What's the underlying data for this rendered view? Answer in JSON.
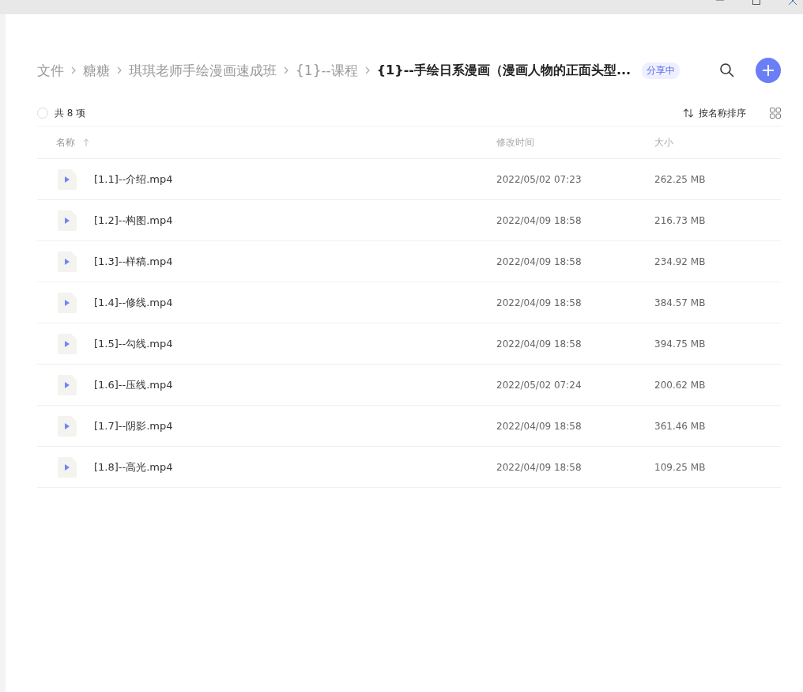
{
  "breadcrumb": [
    {
      "label": "文件",
      "current": false
    },
    {
      "label": "糖糖",
      "current": false
    },
    {
      "label": "琪琪老师手绘漫画速成班",
      "current": false
    },
    {
      "label": "{1}--课程",
      "current": false
    },
    {
      "label": "{1}--手绘日系漫画（漫画人物的正面头型...",
      "current": true
    }
  ],
  "share_badge": "分享中",
  "toolbar": {
    "select_all": {
      "checked": false
    },
    "count": "共 8 项",
    "sort": "按名称排序"
  },
  "table": {
    "columns": [
      {
        "label": "名称",
        "sorted": true
      },
      {
        "label": "修改时间",
        "sorted": false
      },
      {
        "label": "大小",
        "sorted": false
      }
    ],
    "rows": [
      {
        "name": "[1.1]--介绍.mp4",
        "modified": "2022/05/02 07:23",
        "size": "262.25 MB"
      },
      {
        "name": "[1.2]--构图.mp4",
        "modified": "2022/04/09 18:58",
        "size": "216.73 MB"
      },
      {
        "name": "[1.3]--样稿.mp4",
        "modified": "2022/04/09 18:58",
        "size": "234.92 MB"
      },
      {
        "name": "[1.4]--修线.mp4",
        "modified": "2022/04/09 18:58",
        "size": "384.57 MB"
      },
      {
        "name": "[1.5]--勾线.mp4",
        "modified": "2022/04/09 18:58",
        "size": "394.75 MB"
      },
      {
        "name": "[1.6]--压线.mp4",
        "modified": "2022/05/02 07:24",
        "size": "200.62 MB"
      },
      {
        "name": "[1.7]--阴影.mp4",
        "modified": "2022/04/09 18:58",
        "size": "361.46 MB"
      },
      {
        "name": "[1.8]--高光.mp4",
        "modified": "2022/04/09 18:58",
        "size": "109.25 MB"
      }
    ]
  }
}
